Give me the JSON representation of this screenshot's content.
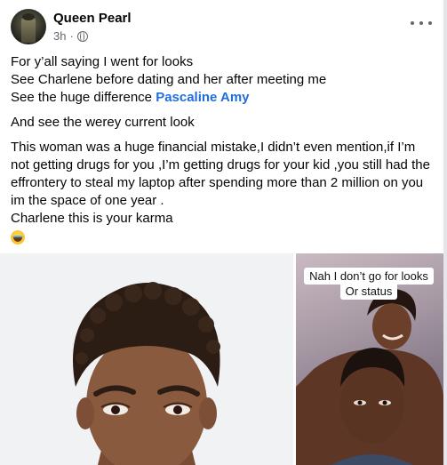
{
  "post": {
    "author_name": "Queen Pearl",
    "time": "3h",
    "separator": "·",
    "privacy_icon": "globe-icon",
    "more_icon": "more-horizontal-icon",
    "lines": [
      "For y’all saying I went for looks",
      "See Charlene before dating and her after meeting me",
      "See the huge difference "
    ],
    "mention": "Pascaline Amy",
    "paragraph2": "And see the werey current look",
    "paragraph3": "This woman was a huge financial mistake,I didn’t even mention,if I’m not getting drugs for you ,I’m getting drugs for your kid ,you still had the effrontery to steal my laptop after spending more than 2 million on you im the space of one year .",
    "paragraph3_end": "Charlene this is your karma",
    "emoji": "tears-of-joy-emoji",
    "photo_right_caption_line1": "Nah I don’t go for looks",
    "photo_right_caption_line2": "Or status"
  },
  "colors": {
    "mention": "#216fdb",
    "secondary_text": "#65676b",
    "text": "#050505"
  }
}
